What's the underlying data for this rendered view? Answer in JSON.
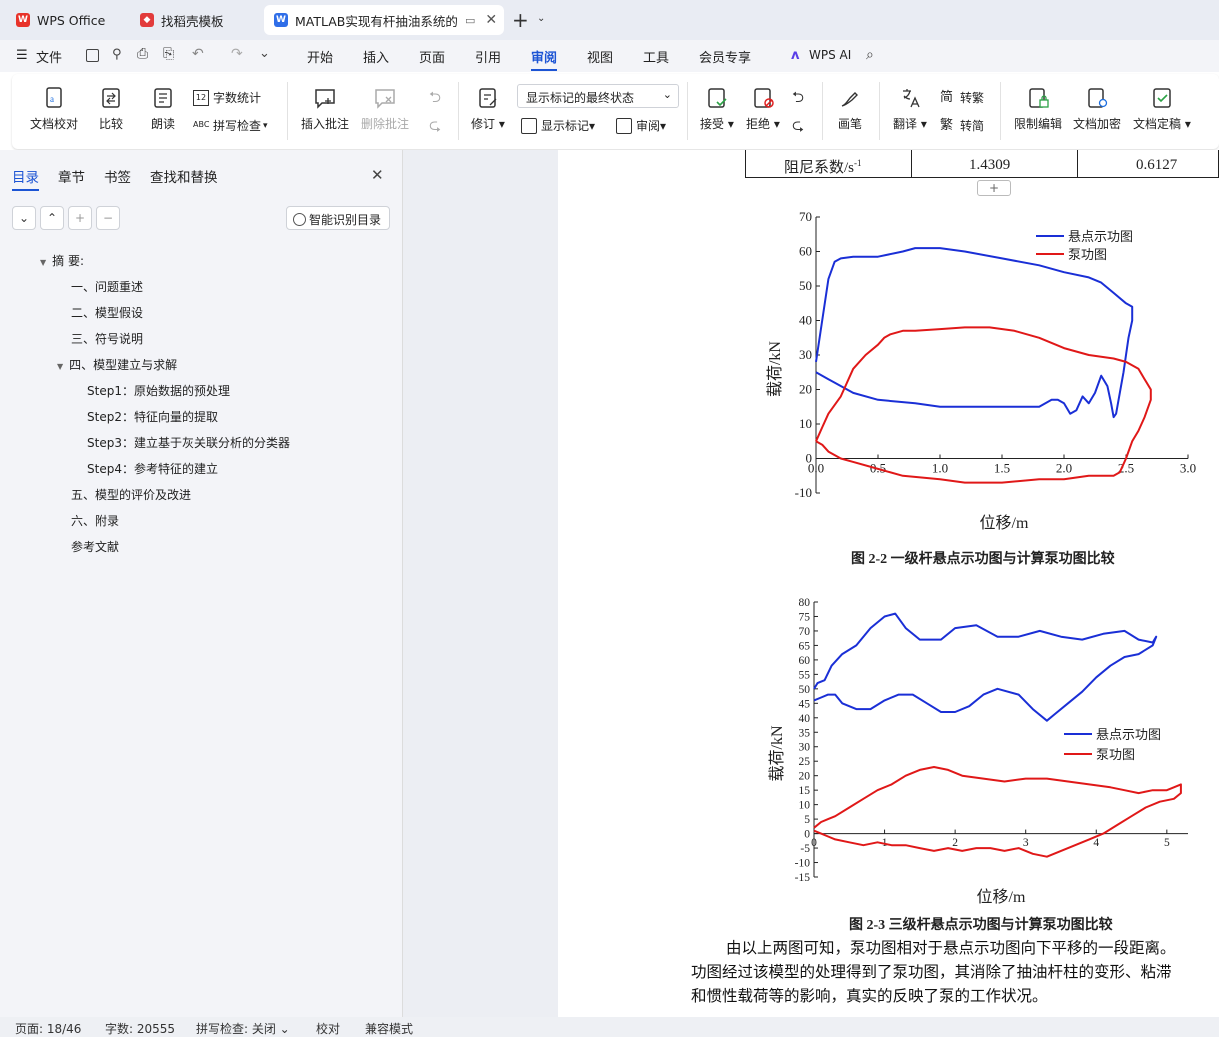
{
  "tabs": {
    "wps": "WPS Office",
    "template": "找稻壳模板",
    "doc": "MATLAB实现有杆抽油系统的",
    "add": "+"
  },
  "menu": {
    "file": "文件",
    "items": [
      "开始",
      "插入",
      "页面",
      "引用",
      "审阅",
      "视图",
      "工具",
      "会员专享"
    ],
    "ai": "WPS AI"
  },
  "ribbon": {
    "doc_check": "文档校对",
    "compare": "比较",
    "read": "朗读",
    "word_count": "字数统计",
    "spell_check": "拼写检查",
    "insert_comment": "插入批注",
    "delete_comment": "删除批注",
    "revise": "修订",
    "display_state": "显示标记的最终状态",
    "show_marks": "显示标记",
    "review": "审阅",
    "accept": "接受",
    "reject": "拒绝",
    "pen": "画笔",
    "translate": "翻译",
    "to_trad": "转繁",
    "to_simp": "转简",
    "restrict": "限制编辑",
    "encrypt": "文档加密",
    "finalize": "文档定稿"
  },
  "left": {
    "tabs": [
      "目录",
      "章节",
      "书签",
      "查找和替换"
    ],
    "smart_btn": "智能识别目录",
    "toc": [
      {
        "text": "摘 要:",
        "level": 0,
        "expanded": true
      },
      {
        "text": "一、问题重述",
        "level": 1
      },
      {
        "text": "二、模型假设",
        "level": 1
      },
      {
        "text": "三、符号说明",
        "level": 1
      },
      {
        "text": "四、模型建立与求解",
        "level": 1,
        "expanded": true
      },
      {
        "text": "Step1：原始数据的预处理",
        "level": 2
      },
      {
        "text": "Step2：特征向量的提取",
        "level": 2
      },
      {
        "text": "Step3：建立基于灰关联分析的分类器",
        "level": 2
      },
      {
        "text": "Step4：参考特征的建立",
        "level": 2
      },
      {
        "text": "五、模型的评价及改进",
        "level": 1
      },
      {
        "text": "六、附录",
        "level": 1
      },
      {
        "text": "参考文献",
        "level": 1
      }
    ]
  },
  "doc": {
    "table_row": {
      "label": "阻尼系数/s",
      "sup": "-1",
      "v1": "1.4309",
      "v2": "0.6127"
    },
    "caption1": "图 2-2 一级杆悬点示功图与计算泵功图比较",
    "caption2": "图 2-3 三级杆悬点示功图与计算泵功图比较",
    "para_lines": [
      "由以上两图可知，泵功图相对于悬点示功图向下平移的一段距离。",
      "功图经过该模型的处理得到了泵功图，其消除了抽油杆柱的变形、粘滞",
      "和惯性载荷等的影响，真实的反映了泵的工作状况。"
    ]
  },
  "chart_data": [
    {
      "type": "line",
      "xlabel": "位移/m",
      "ylabel": "载荷/kN",
      "xlim": [
        0,
        3.0
      ],
      "ylim": [
        -10,
        70
      ],
      "xticks": [
        "0.0",
        "0.5",
        "1.0",
        "1.5",
        "2.0",
        "2.5",
        "3.0"
      ],
      "yticks": [
        "-10",
        "0",
        "10",
        "20",
        "30",
        "40",
        "50",
        "60",
        "70"
      ],
      "legend_position": "top-right",
      "series": [
        {
          "name": "悬点示功图",
          "color": "#1a2fd6",
          "x": [
            0.0,
            0.05,
            0.1,
            0.15,
            0.2,
            0.3,
            0.5,
            0.7,
            0.8,
            1.0,
            1.2,
            1.5,
            1.8,
            2.0,
            2.2,
            2.3,
            2.4,
            2.5,
            2.55,
            2.55,
            2.52,
            2.5,
            2.48,
            2.45,
            2.42,
            2.4,
            2.38,
            2.35,
            2.3,
            2.25,
            2.2,
            2.15,
            2.1,
            2.05,
            2.0,
            1.95,
            1.9,
            1.8,
            1.5,
            1.3,
            1.0,
            0.8,
            0.5,
            0.3,
            0.1,
            0.0
          ],
          "y": [
            28,
            40,
            52,
            57,
            58,
            58.5,
            58.5,
            60,
            61,
            61,
            60,
            58,
            56,
            54,
            52.5,
            51,
            48,
            45,
            44,
            40,
            35,
            30,
            25,
            19,
            13,
            12,
            16,
            21,
            24,
            19,
            16,
            18,
            14,
            13,
            16,
            17,
            17,
            15,
            15,
            15,
            15,
            16,
            17,
            19,
            23,
            25
          ]
        },
        {
          "name": "泵功图",
          "color": "#e01818",
          "x": [
            0.0,
            0.05,
            0.1,
            0.2,
            0.25,
            0.3,
            0.4,
            0.5,
            0.55,
            0.6,
            0.7,
            0.8,
            1.0,
            1.2,
            1.4,
            1.6,
            1.8,
            2.0,
            2.2,
            2.4,
            2.5,
            2.6,
            2.65,
            2.7,
            2.7,
            2.65,
            2.6,
            2.55,
            2.5,
            2.45,
            2.4,
            2.3,
            2.2,
            2.0,
            1.8,
            1.5,
            1.2,
            1.0,
            0.7,
            0.5,
            0.3,
            0.2,
            0.1,
            0.05,
            0.0
          ],
          "y": [
            5,
            9,
            13,
            18,
            22,
            26,
            30,
            33,
            35,
            36,
            37,
            37,
            37.5,
            38,
            38,
            37,
            35,
            32,
            30,
            29,
            28,
            26,
            23,
            20,
            17,
            12,
            8,
            5,
            0,
            -4,
            -5,
            -5,
            -5,
            -6,
            -6,
            -7,
            -7,
            -6,
            -5,
            -3,
            -1,
            0,
            2,
            4,
            5
          ]
        }
      ]
    },
    {
      "type": "line",
      "xlabel": "位移/m",
      "ylabel": "载荷/kN",
      "xlim": [
        0,
        5.3
      ],
      "ylim": [
        -15,
        80
      ],
      "xticks": [
        "0",
        "1",
        "2",
        "3",
        "4",
        "5"
      ],
      "yticks": [
        "-15",
        "-10",
        "-5",
        "0",
        "5",
        "10",
        "15",
        "20",
        "25",
        "30",
        "35",
        "40",
        "45",
        "50",
        "55",
        "60",
        "65",
        "70",
        "75",
        "80"
      ],
      "legend_position": "right",
      "series": [
        {
          "name": "悬点示功图",
          "color": "#1a2fd6",
          "x": [
            0.0,
            0.05,
            0.15,
            0.25,
            0.4,
            0.6,
            0.8,
            1.0,
            1.15,
            1.3,
            1.5,
            1.8,
            2.0,
            2.3,
            2.6,
            2.9,
            3.2,
            3.5,
            3.8,
            4.1,
            4.4,
            4.6,
            4.8,
            4.85,
            4.8,
            4.6,
            4.4,
            4.2,
            4.0,
            3.8,
            3.6,
            3.4,
            3.3,
            3.1,
            2.9,
            2.6,
            2.4,
            2.2,
            2.0,
            1.8,
            1.6,
            1.4,
            1.2,
            1.0,
            0.8,
            0.6,
            0.4,
            0.3,
            0.2,
            0.1,
            0.0
          ],
          "y": [
            50,
            52,
            53,
            58,
            62,
            65,
            71,
            75,
            76,
            71,
            67,
            67,
            71,
            72,
            68,
            68,
            70,
            68,
            67,
            69,
            70,
            67,
            66,
            68,
            65,
            62,
            61,
            58,
            54,
            49,
            45,
            41,
            39,
            43,
            48,
            50,
            48,
            44,
            42,
            42,
            45,
            48,
            48,
            46,
            43,
            43,
            45,
            48,
            48,
            47,
            46
          ]
        },
        {
          "name": "泵功图",
          "color": "#e01818",
          "x": [
            0.0,
            0.1,
            0.2,
            0.3,
            0.5,
            0.7,
            0.9,
            1.1,
            1.3,
            1.5,
            1.7,
            1.9,
            2.1,
            2.4,
            2.7,
            3.0,
            3.3,
            3.6,
            3.9,
            4.2,
            4.4,
            4.6,
            4.8,
            5.0,
            5.1,
            5.2,
            5.2,
            5.1,
            4.9,
            4.7,
            4.5,
            4.3,
            4.1,
            3.9,
            3.7,
            3.5,
            3.3,
            3.1,
            2.9,
            2.7,
            2.5,
            2.3,
            2.1,
            1.9,
            1.7,
            1.5,
            1.3,
            1.1,
            0.9,
            0.7,
            0.5,
            0.3,
            0.2,
            0.1,
            0.0
          ],
          "y": [
            2,
            4,
            5,
            6,
            9,
            12,
            15,
            17,
            20,
            22,
            23,
            22,
            20,
            19,
            18,
            19,
            19,
            18,
            17,
            16,
            15,
            14,
            15,
            15,
            16,
            17,
            14,
            12,
            11,
            9,
            6,
            3,
            0,
            -2,
            -4,
            -6,
            -8,
            -7,
            -5,
            -6,
            -5,
            -5,
            -6,
            -5,
            -6,
            -5,
            -4,
            -4,
            -3,
            -4,
            -3,
            -2,
            -1,
            0,
            1
          ]
        }
      ]
    }
  ],
  "status": {
    "page": "页面: 18/46",
    "words": "字数: 20555",
    "spell": "拼写检查: 关闭",
    "proof": "校对",
    "compat": "兼容模式"
  }
}
